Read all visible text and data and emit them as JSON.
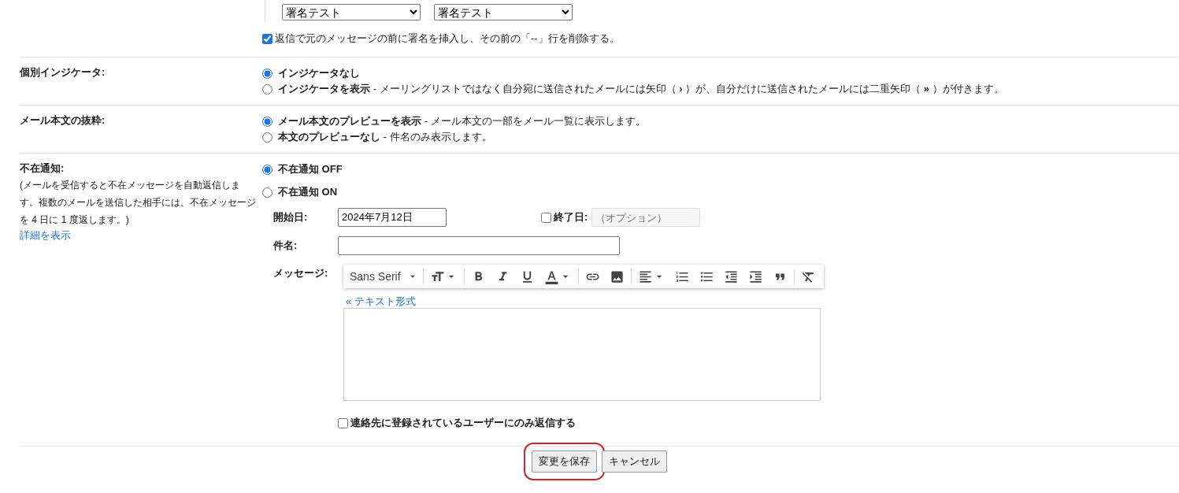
{
  "signature": {
    "selects": [
      "署名テスト",
      "署名テスト"
    ],
    "insert_option": {
      "label": "返信で元のメッセージの前に署名を挿入し、その前の「--」行を削除する。",
      "checked": true
    }
  },
  "sections": [
    {
      "label": "個別インジケータ:",
      "options": [
        {
          "title": "インジケータなし",
          "selected": true
        },
        {
          "title": "インジケータを表示",
          "description": "- メーリングリストではなく自分宛に送信されたメールには矢印（ **›** ）が、自分だけに送信されたメールには二重矢印（ **»** ）が付きます。",
          "selected": false
        }
      ]
    },
    {
      "label": "メール本文の抜粋:",
      "options": [
        {
          "title": "メール本文のプレビューを表示",
          "description": "- メール本文の一部をメール一覧に表示します。",
          "selected": true
        },
        {
          "title": "本文のプレビューなし",
          "description": "- 件名のみ表示します。",
          "selected": false
        }
      ]
    }
  ],
  "vacation": {
    "label": "不在通知:",
    "description": "(メールを受信すると不在メッセージを自動返信します。複数のメールを送信した相手には、不在メッセージを 4 日に 1 度返します。)",
    "details_link": "詳細を表示",
    "options": [
      {
        "title": "不在通知 OFF",
        "selected": true
      },
      {
        "title": "不在通知 ON",
        "selected": false
      }
    ],
    "start_date": {
      "label": "開始日:",
      "value": "2024年7月12日"
    },
    "end_date": {
      "label": "終了日:",
      "checked": false,
      "placeholder": "（オプション）"
    },
    "subject": {
      "label": "件名:"
    },
    "message": {
      "label": "メッセージ:",
      "font": "Sans Serif",
      "plain_text_link": "« テキスト形式"
    },
    "contacts_only": {
      "label": "連絡先に登録されているユーザーにのみ返信する",
      "checked": false
    }
  },
  "buttons": [
    {
      "label": "変更を保存",
      "highlighted": true
    },
    {
      "label": "キャンセル",
      "highlighted": false
    }
  ]
}
